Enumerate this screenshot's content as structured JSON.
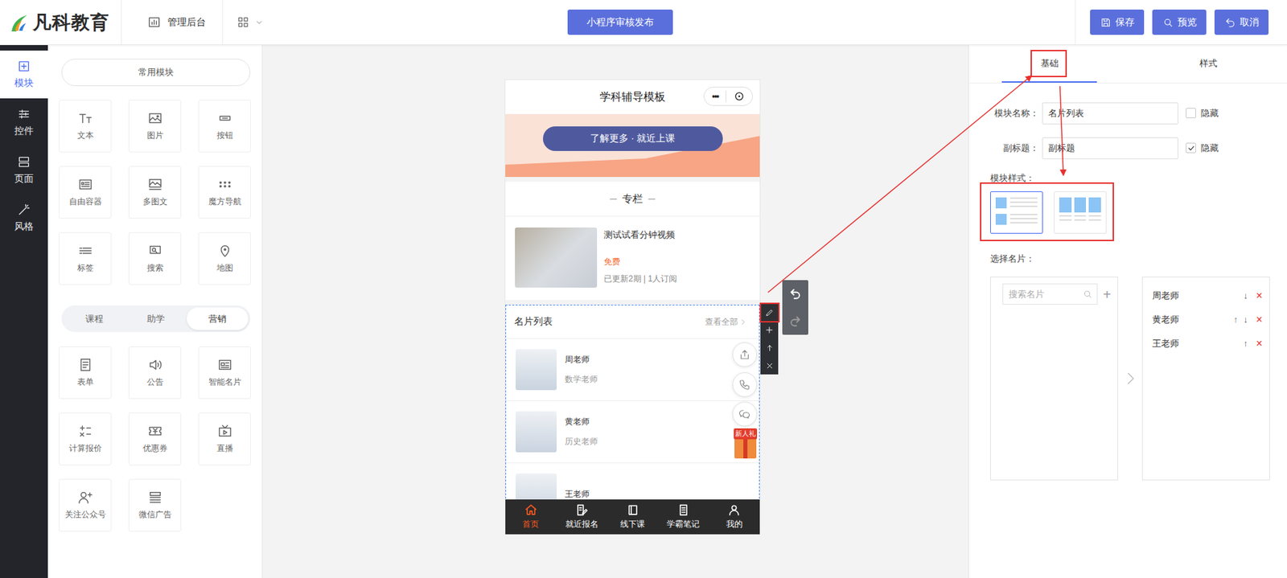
{
  "topbar": {
    "logo": "凡科教育",
    "admin": "管理后台",
    "publish": "小程序审核发布",
    "actions": [
      {
        "label": "保存"
      },
      {
        "label": "预览"
      },
      {
        "label": "取消"
      }
    ]
  },
  "sidebar": [
    {
      "label": "模块",
      "selected": true
    },
    {
      "label": "控件",
      "selected": false
    },
    {
      "label": "页面",
      "selected": false
    },
    {
      "label": "风格",
      "selected": false
    }
  ],
  "module_panel": {
    "common": "常用模块",
    "common_items": [
      "文本",
      "图片",
      "按钮",
      "自由容器",
      "多图文",
      "魔方导航",
      "标签",
      "搜索",
      "地图"
    ],
    "tabs": [
      {
        "label": "课程",
        "selected": false
      },
      {
        "label": "助学",
        "selected": false
      },
      {
        "label": "营销",
        "selected": true
      }
    ],
    "items": [
      "表单",
      "公告",
      "智能名片",
      "计算报价",
      "优惠券",
      "直播",
      "关注公众号",
      "微信广告"
    ]
  },
  "phone": {
    "title": "学科辅导模板",
    "capsule": "•••",
    "banner_button": "了解更多 · 就近上课",
    "section": "专栏",
    "course": {
      "title": "测试试看分钟视频",
      "price": "免费",
      "meta": "已更新2期 | 1人订阅"
    },
    "card_module": {
      "title": "名片列表",
      "more": "查看全部",
      "cards": [
        {
          "name": "周老师",
          "role": "数学老师"
        },
        {
          "name": "黄老师",
          "role": "历史老师"
        },
        {
          "name": "王老师"
        }
      ]
    },
    "gift": "新人礼",
    "tabs": [
      {
        "label": "首页",
        "selected": true
      },
      {
        "label": "就近报名",
        "selected": false
      },
      {
        "label": "线下课",
        "selected": false
      },
      {
        "label": "学霸笔记",
        "selected": false
      },
      {
        "label": "我的",
        "selected": false
      }
    ]
  },
  "settings": {
    "tabs": [
      {
        "label": "基础",
        "selected": true
      },
      {
        "label": "样式",
        "selected": false
      }
    ],
    "fields": [
      {
        "label": "模块名称：",
        "value": "名片列表",
        "hide_label": "隐藏",
        "hidden": false
      },
      {
        "label": "副标题：",
        "value": "副标题",
        "hide_label": "隐藏",
        "hidden": true
      }
    ],
    "style_label": "模块样式：",
    "styles": [
      {
        "kind": "list",
        "selected": true
      },
      {
        "kind": "grid",
        "selected": false
      }
    ],
    "cards_label": "选择名片：",
    "search_placeholder": "搜索名片",
    "add": "+",
    "selected_cards": [
      {
        "name": "周老师",
        "moves": [
          "↓"
        ]
      },
      {
        "name": "黄老师",
        "moves": [
          "↑",
          "↓"
        ]
      },
      {
        "name": "王老师",
        "moves": [
          "↑"
        ]
      }
    ],
    "remove": "×"
  }
}
